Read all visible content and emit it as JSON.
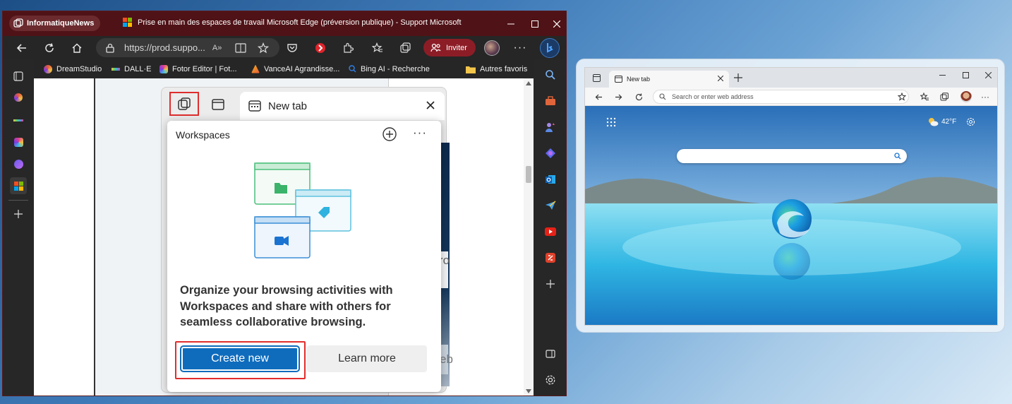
{
  "browser": {
    "workspace_name": "InformatiqueNews",
    "tab_title": "Prise en main des espaces de travail Microsoft Edge (préversion publique) - Support Microsoft",
    "address": "https://prod.suppo...",
    "invite_label": "Inviter",
    "favorites": [
      {
        "label": "DreamStudio",
        "color": "#e85a3a"
      },
      {
        "label": "DALL·E",
        "color": "#f0c040"
      },
      {
        "label": "Fotor Editor | Fot...",
        "color": "#e0408a"
      },
      {
        "label": "VanceAI Agrandisse...",
        "color": "#f2b01e"
      },
      {
        "label": "Bing AI - Recherche",
        "color": "#2f7de1"
      }
    ],
    "other_favorites": "Autres favoris"
  },
  "popup": {
    "tab_label": "New tab",
    "heading": "Workspaces",
    "description": "Organize your browsing activities with Workspaces and share with others for seamless collaborative browsing.",
    "primary_button": "Create new",
    "secondary_button": "Learn more",
    "page_fragment_1": "ro",
    "page_fragment_2": "eb"
  },
  "second_window": {
    "tab_label": "New tab",
    "address_placeholder": "Search or enter web address",
    "weather": "42°F"
  },
  "colors": {
    "titlebar": "#4f1216",
    "accent_blue": "#0f6cbd",
    "highlight_red": "#e02d2d"
  }
}
